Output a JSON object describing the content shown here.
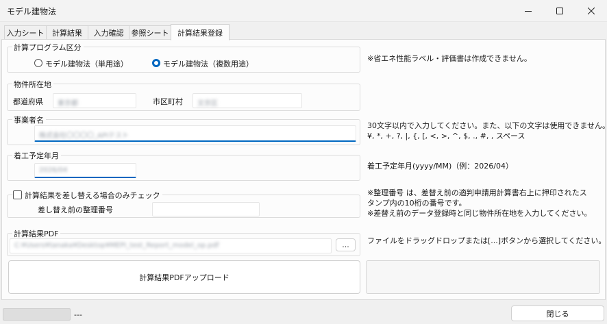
{
  "window": {
    "title": "モデル建物法"
  },
  "tabs": [
    "入力シート",
    "計算結果",
    "入力確認",
    "参照シート",
    "計算結果登録"
  ],
  "program": {
    "legend": "計算プログラム区分",
    "option_single": "モデル建物法（単用途）",
    "option_multi": "モデル建物法（複数用途）",
    "selected": "option_multi",
    "note": "※省エネ性能ラベル・評価書は作成できません。"
  },
  "location": {
    "legend": "物件所在地",
    "pref_label": "都道府県",
    "pref_value": "東京都",
    "city_label": "市区町村",
    "city_value": "文京区"
  },
  "business": {
    "legend": "事業者名",
    "value": "株式会社〇〇〇〇_APIテスト",
    "note1": "30文字以内で入力してください。また、以下の文字は使用できません。",
    "note2": "¥, *, +, ?, |, {, [, <, >, ^, $, ., #, , スペース"
  },
  "start": {
    "legend": "着工予定年月",
    "value": "2026/04",
    "note": "着工予定年月(yyyy/MM)（例：2026/04）"
  },
  "replace": {
    "check_label": "計算結果を差し替える場合のみチェック",
    "number_label": "差し替え前の整理番号",
    "number_value": "",
    "note1": "※整理番号 は、差替え前の適判申請用計算書右上に押印されたス",
    "note2": "タンプ内の10桁の番号です。",
    "note3": "※差替え前のデータ登録時と同じ物件所在地を入力してください。"
  },
  "pdf": {
    "legend": "計算結果PDF",
    "path": "C:¥Users¥tanaka¥Desktop¥MEPI_test_Report_model_op.pdf",
    "browse_label": "...",
    "note": "ファイルをドラッグドロップまたは[...]ボタンから選択してください。",
    "upload_label": "計算結果PDFアップロード"
  },
  "statusbar": {
    "text": "---",
    "close_label": "閉じる"
  }
}
